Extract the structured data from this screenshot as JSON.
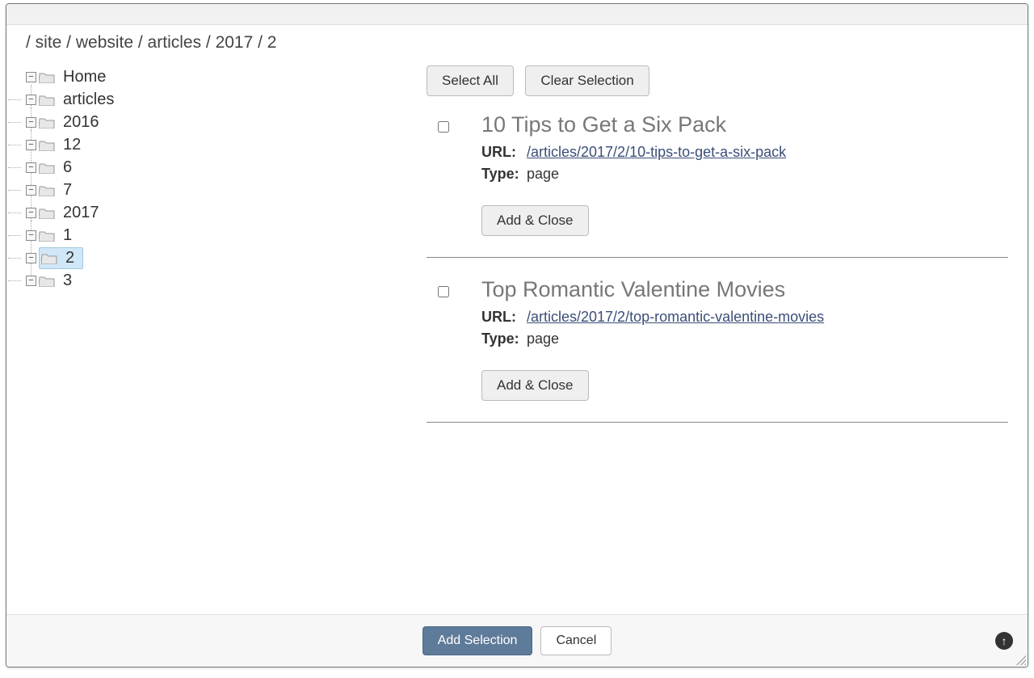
{
  "breadcrumb": "/ site / website / articles / 2017 / 2",
  "tree": {
    "home": "Home",
    "articles": "articles",
    "y2016": "2016",
    "m12": "12",
    "m6": "6",
    "m7": "7",
    "y2017": "2017",
    "m1": "1",
    "m2": "2",
    "m3": "3"
  },
  "toolbar": {
    "select_all": "Select All",
    "clear_selection": "Clear Selection"
  },
  "labels": {
    "url": "URL:",
    "type": "Type:",
    "add_close": "Add & Close"
  },
  "items": [
    {
      "title": "10 Tips to Get a Six Pack",
      "url": "/articles/2017/2/10-tips-to-get-a-six-pack",
      "type": "page"
    },
    {
      "title": "Top Romantic Valentine Movies",
      "url": "/articles/2017/2/top-romantic-valentine-movies",
      "type": "page"
    }
  ],
  "footer": {
    "add_selection": "Add Selection",
    "cancel": "Cancel"
  }
}
